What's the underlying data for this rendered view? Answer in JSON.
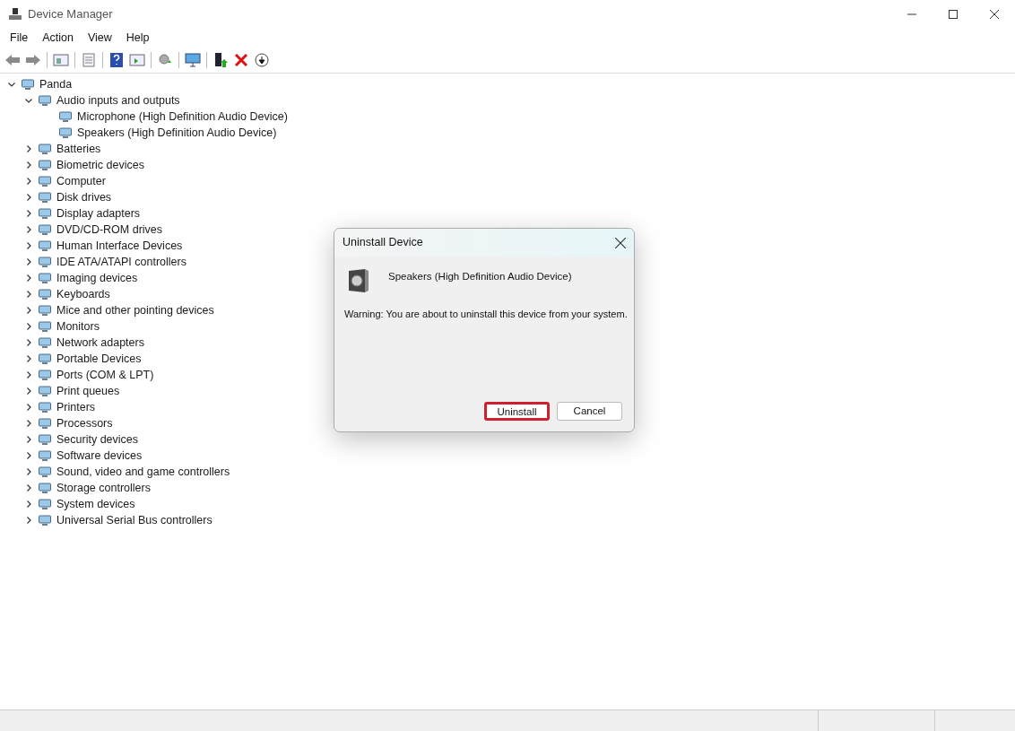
{
  "window": {
    "title": "Device Manager"
  },
  "menu": [
    "File",
    "Action",
    "View",
    "Help"
  ],
  "tree": {
    "label": "Panda",
    "expanded": true,
    "children": [
      {
        "label": "Audio inputs and outputs",
        "expanded": true,
        "children": [
          {
            "label": "Microphone (High Definition Audio Device)"
          },
          {
            "label": "Speakers (High Definition Audio Device)"
          }
        ]
      },
      {
        "label": "Batteries",
        "expanded": false
      },
      {
        "label": "Biometric devices",
        "expanded": false
      },
      {
        "label": "Computer",
        "expanded": false
      },
      {
        "label": "Disk drives",
        "expanded": false
      },
      {
        "label": "Display adapters",
        "expanded": false
      },
      {
        "label": "DVD/CD-ROM drives",
        "expanded": false
      },
      {
        "label": "Human Interface Devices",
        "expanded": false
      },
      {
        "label": "IDE ATA/ATAPI controllers",
        "expanded": false
      },
      {
        "label": "Imaging devices",
        "expanded": false
      },
      {
        "label": "Keyboards",
        "expanded": false
      },
      {
        "label": "Mice and other pointing devices",
        "expanded": false
      },
      {
        "label": "Monitors",
        "expanded": false
      },
      {
        "label": "Network adapters",
        "expanded": false
      },
      {
        "label": "Portable Devices",
        "expanded": false
      },
      {
        "label": "Ports (COM & LPT)",
        "expanded": false
      },
      {
        "label": "Print queues",
        "expanded": false
      },
      {
        "label": "Printers",
        "expanded": false
      },
      {
        "label": "Processors",
        "expanded": false
      },
      {
        "label": "Security devices",
        "expanded": false
      },
      {
        "label": "Software devices",
        "expanded": false
      },
      {
        "label": "Sound, video and game controllers",
        "expanded": false
      },
      {
        "label": "Storage controllers",
        "expanded": false
      },
      {
        "label": "System devices",
        "expanded": false
      },
      {
        "label": "Universal Serial Bus controllers",
        "expanded": false
      }
    ]
  },
  "dialog": {
    "title": "Uninstall Device",
    "device": "Speakers (High Definition Audio Device)",
    "warning": "Warning: You are about to uninstall this device from your system.",
    "buttons": [
      {
        "label": "Uninstall",
        "highlighted": true
      },
      {
        "label": "Cancel",
        "highlighted": false
      }
    ]
  }
}
